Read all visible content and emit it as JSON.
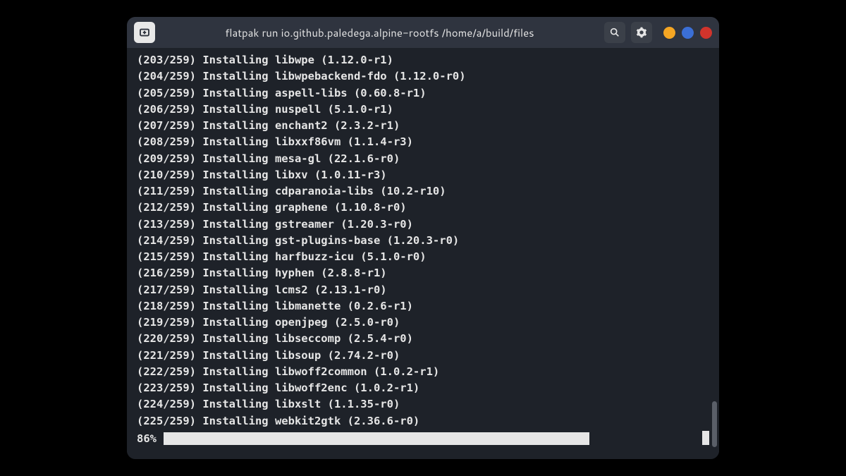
{
  "titlebar": {
    "title": "flatpak run io.github.paledega.alpine-rootfs /home/a/build/files"
  },
  "log": {
    "total": 259,
    "action": "Installing",
    "lines": [
      {
        "n": 203,
        "pkg": "libwpe",
        "ver": "1.12.0-r1"
      },
      {
        "n": 204,
        "pkg": "libwpebackend-fdo",
        "ver": "1.12.0-r0"
      },
      {
        "n": 205,
        "pkg": "aspell-libs",
        "ver": "0.60.8-r1"
      },
      {
        "n": 206,
        "pkg": "nuspell",
        "ver": "5.1.0-r1"
      },
      {
        "n": 207,
        "pkg": "enchant2",
        "ver": "2.3.2-r1"
      },
      {
        "n": 208,
        "pkg": "libxxf86vm",
        "ver": "1.1.4-r3"
      },
      {
        "n": 209,
        "pkg": "mesa-gl",
        "ver": "22.1.6-r0"
      },
      {
        "n": 210,
        "pkg": "libxv",
        "ver": "1.0.11-r3"
      },
      {
        "n": 211,
        "pkg": "cdparanoia-libs",
        "ver": "10.2-r10"
      },
      {
        "n": 212,
        "pkg": "graphene",
        "ver": "1.10.8-r0"
      },
      {
        "n": 213,
        "pkg": "gstreamer",
        "ver": "1.20.3-r0"
      },
      {
        "n": 214,
        "pkg": "gst-plugins-base",
        "ver": "1.20.3-r0"
      },
      {
        "n": 215,
        "pkg": "harfbuzz-icu",
        "ver": "5.1.0-r0"
      },
      {
        "n": 216,
        "pkg": "hyphen",
        "ver": "2.8.8-r1"
      },
      {
        "n": 217,
        "pkg": "lcms2",
        "ver": "2.13.1-r0"
      },
      {
        "n": 218,
        "pkg": "libmanette",
        "ver": "0.2.6-r1"
      },
      {
        "n": 219,
        "pkg": "openjpeg",
        "ver": "2.5.0-r0"
      },
      {
        "n": 220,
        "pkg": "libseccomp",
        "ver": "2.5.4-r0"
      },
      {
        "n": 221,
        "pkg": "libsoup",
        "ver": "2.74.2-r0"
      },
      {
        "n": 222,
        "pkg": "libwoff2common",
        "ver": "1.0.2-r1"
      },
      {
        "n": 223,
        "pkg": "libwoff2enc",
        "ver": "1.0.2-r1"
      },
      {
        "n": 224,
        "pkg": "libxslt",
        "ver": "1.1.35-r0"
      },
      {
        "n": 225,
        "pkg": "webkit2gtk",
        "ver": "2.36.6-r0"
      }
    ]
  },
  "progress": {
    "percent_label": "86%",
    "percent_value": 86,
    "bar_width_pct": 78
  },
  "scrollbar": {
    "top_pct": 86,
    "height_pct": 11
  }
}
